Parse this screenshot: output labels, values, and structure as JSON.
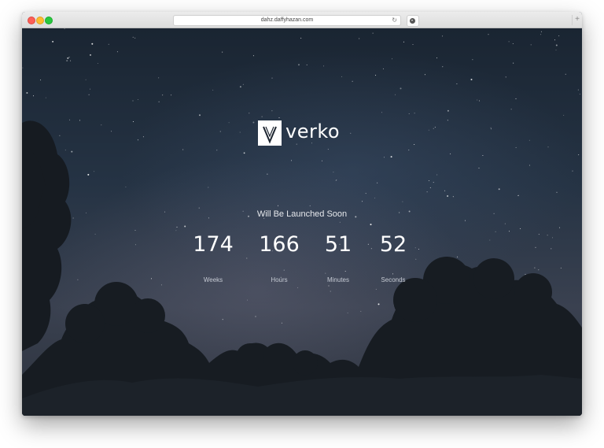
{
  "browser": {
    "url": "dahz.daffyhazan.com",
    "newtab_glyph": "+",
    "reload_glyph": "↻"
  },
  "page": {
    "brand": "verko",
    "subtitle": "Will Be Launched Soon",
    "countdown": [
      {
        "value": "174",
        "label": "Weeks"
      },
      {
        "value": "166",
        "label": "Hours"
      },
      {
        "value": "51",
        "label": "Minutes"
      },
      {
        "value": "52",
        "label": "Seconds"
      }
    ]
  },
  "colors": {
    "sky_top": "#1a2532",
    "sky_glow": "#3a4150",
    "text": "#ffffff",
    "logo_box": "#ffffff"
  },
  "icons": [
    "close-dot-icon",
    "minimize-dot-icon",
    "maximize-dot-icon",
    "reload-icon",
    "download-icon",
    "new-tab-icon",
    "verko-logo-icon"
  ]
}
